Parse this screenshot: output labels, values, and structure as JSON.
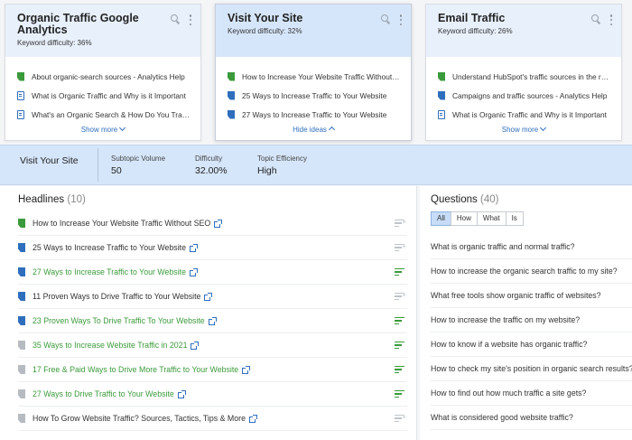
{
  "cards": [
    {
      "title": "Organic Traffic Google Analytics",
      "difficulty": "Keyword difficulty: 36%",
      "items": [
        {
          "text": "About organic-search sources - Analytics Help",
          "source": "green"
        },
        {
          "text": "What is Organic Traffic and Why is it Important",
          "source": "doc"
        },
        {
          "text": "What's an Organic Search & How Do You Track It",
          "source": "doc"
        }
      ],
      "footer": "Show more"
    },
    {
      "title": "Visit Your Site",
      "difficulty": "Keyword difficulty: 32%",
      "items": [
        {
          "text": "How to Increase Your Website Traffic Without SEO",
          "source": "green"
        },
        {
          "text": "25 Ways to Increase Traffic to Your Website",
          "source": "hub"
        },
        {
          "text": "27 Ways to Increase Traffic to Your Website",
          "source": "hub"
        }
      ],
      "footer": "Hide ideas"
    },
    {
      "title": "Email Traffic",
      "difficulty": "Keyword difficulty: 26%",
      "items": [
        {
          "text": "Understand HubSpot's traffic sources in the report",
          "source": "green"
        },
        {
          "text": "Campaigns and traffic sources - Analytics Help",
          "source": "hub"
        },
        {
          "text": "What is Organic Traffic and Why is it Important",
          "source": "doc"
        }
      ],
      "footer": "Show more"
    }
  ],
  "topic": {
    "title": "Visit Your Site",
    "metrics": [
      {
        "label": "Subtopic Volume",
        "value": "50"
      },
      {
        "label": "Difficulty",
        "value": "32.00%"
      },
      {
        "label": "Topic Efficiency",
        "value": "High"
      }
    ]
  },
  "headlines": {
    "title": "Headlines",
    "count": "(10)",
    "rows": [
      {
        "text": "How to Increase Your Website Traffic Without SEO",
        "style": "dark",
        "source": "green",
        "added": false
      },
      {
        "text": "25 Ways to Increase Traffic to Your Website",
        "style": "dark",
        "source": "hub",
        "added": false
      },
      {
        "text": "27 Ways to Increase Traffic to Your Website",
        "style": "green",
        "source": "hub",
        "added": true
      },
      {
        "text": "11 Proven Ways to Drive Traffic to Your Website",
        "style": "dark",
        "source": "hub",
        "added": false
      },
      {
        "text": "23 Proven Ways To Drive Traffic To Your Website",
        "style": "green",
        "source": "hub",
        "added": true
      },
      {
        "text": "35 Ways to Increase Website Traffic in 2021",
        "style": "green",
        "source": "gray",
        "added": true
      },
      {
        "text": "17 Free & Paid Ways to Drive More Traffic to Your Website",
        "style": "green",
        "source": "gray",
        "added": true
      },
      {
        "text": "27 Ways to Drive Traffic to Your Website",
        "style": "green",
        "source": "gray",
        "added": true
      },
      {
        "text": "How To Grow Website Traffic? Sources, Tactics, Tips & More",
        "style": "dark",
        "source": "gray",
        "added": false
      }
    ]
  },
  "questions": {
    "title": "Questions",
    "count": "(40)",
    "filters": [
      "All",
      "How",
      "What",
      "Is"
    ],
    "active_filter": "All",
    "rows": [
      "What is organic traffic and normal traffic?",
      "How to increase the organic search traffic to my site?",
      "What free tools show organic traffic of websites?",
      "How to increase the traffic on my website?",
      "How to know if a website has organic traffic?",
      "How to check my site's position in organic search results?",
      "How to find out how much traffic a site gets?",
      "What is considered good website traffic?"
    ]
  },
  "colors": {
    "accent": "#2f6ebd",
    "green": "#3b9a3b",
    "card_header": "#e8f0fb",
    "topic_bar": "#d6e6fa"
  }
}
